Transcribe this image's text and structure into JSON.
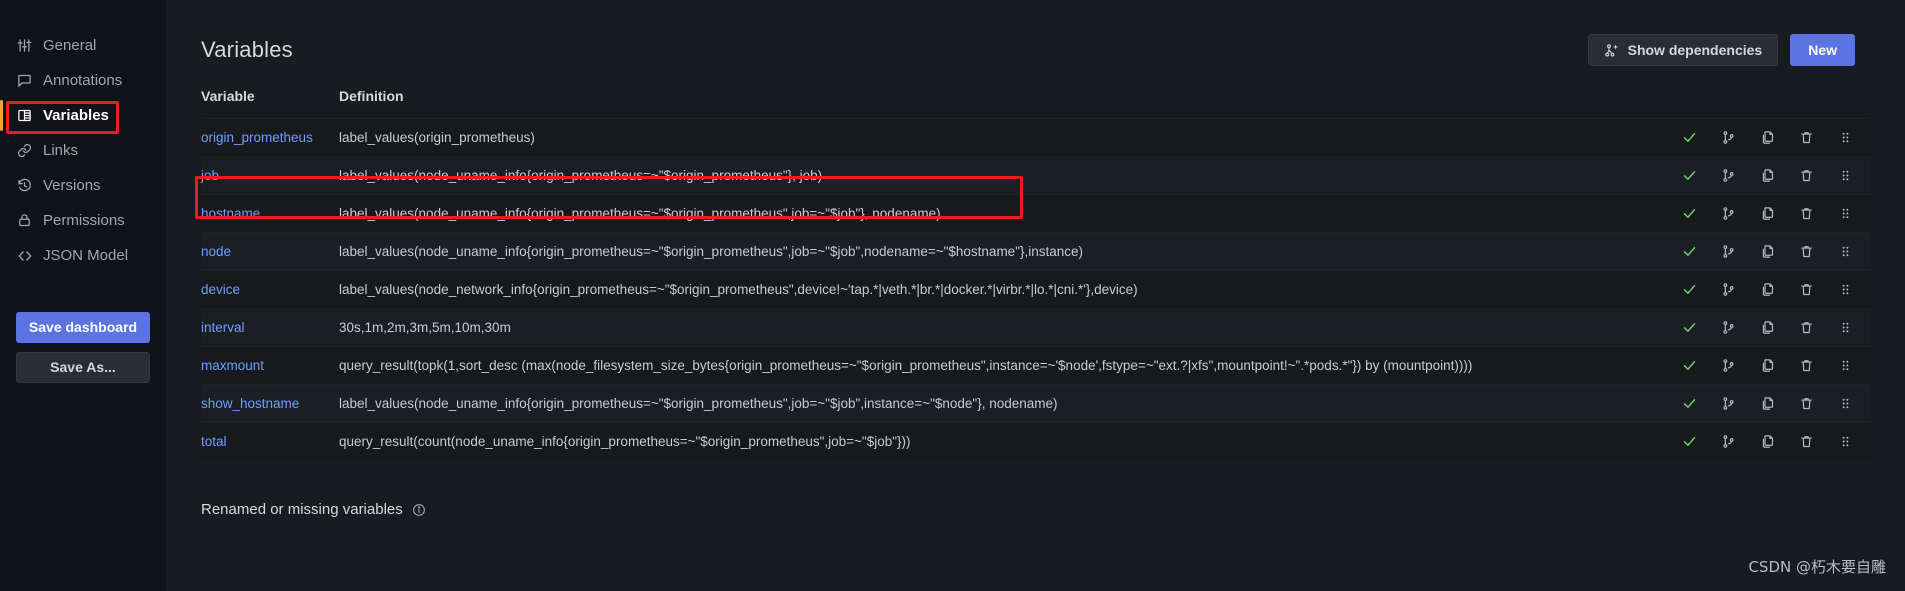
{
  "sidebar": {
    "items": [
      {
        "label": "General",
        "icon": "sliders-icon",
        "active": false
      },
      {
        "label": "Annotations",
        "icon": "comment-square-icon",
        "active": false
      },
      {
        "label": "Variables",
        "icon": "table-grid-icon",
        "active": true
      },
      {
        "label": "Links",
        "icon": "link-icon",
        "active": false
      },
      {
        "label": "Versions",
        "icon": "history-icon",
        "active": false
      },
      {
        "label": "Permissions",
        "icon": "lock-icon",
        "active": false
      },
      {
        "label": "JSON Model",
        "icon": "code-brackets-icon",
        "active": false
      }
    ],
    "save_dashboard_label": "Save dashboard",
    "save_as_label": "Save As..."
  },
  "header": {
    "title": "Variables",
    "show_dependencies_label": "Show dependencies",
    "show_dependencies_icon": "dependency-graph-icon",
    "new_label": "New"
  },
  "table": {
    "columns": [
      "Variable",
      "Definition"
    ],
    "column_variable": "Variable",
    "column_definition": "Definition",
    "row_action_icons": [
      "check-icon",
      "code-branch-icon",
      "duplicate-icon",
      "trash-icon",
      "drag-handle-icon"
    ],
    "rows": [
      {
        "name": "origin_prometheus",
        "definition": "label_values(origin_prometheus)"
      },
      {
        "name": "job",
        "definition": "label_values(node_uname_info{origin_prometheus=~\"$origin_prometheus\"}, job)",
        "highlighted": true
      },
      {
        "name": "hostname",
        "definition": "label_values(node_uname_info{origin_prometheus=~\"$origin_prometheus\",job=~\"$job\"}, nodename)"
      },
      {
        "name": "node",
        "definition": "label_values(node_uname_info{origin_prometheus=~\"$origin_prometheus\",job=~\"$job\",nodename=~\"$hostname\"},instance)"
      },
      {
        "name": "device",
        "definition": "label_values(node_network_info{origin_prometheus=~\"$origin_prometheus\",device!~'tap.*|veth.*|br.*|docker.*|virbr.*|lo.*|cni.*'},device)"
      },
      {
        "name": "interval",
        "definition": "30s,1m,2m,3m,5m,10m,30m"
      },
      {
        "name": "maxmount",
        "definition": "query_result(topk(1,sort_desc (max(node_filesystem_size_bytes{origin_prometheus=~\"$origin_prometheus\",instance=~'$node',fstype=~\"ext.?|xfs\",mountpoint!~\".*pods.*\"}) by (mountpoint))))"
      },
      {
        "name": "show_hostname",
        "definition": "label_values(node_uname_info{origin_prometheus=~\"$origin_prometheus\",job=~\"$job\",instance=~\"$node\"}, nodename)"
      },
      {
        "name": "total",
        "definition": "query_result(count(node_uname_info{origin_prometheus=~\"$origin_prometheus\",job=~\"$job\"}))"
      }
    ]
  },
  "footer": {
    "renamed_missing_label": "Renamed or missing variables",
    "info_icon": "info-circle-icon"
  },
  "watermark": "CSDN @朽木要自雕",
  "colors": {
    "accent_blue": "#5b74e2",
    "link_blue": "#6e9fff",
    "annotation_red": "#ef1b1b",
    "active_marker": "#f2a531",
    "check_green": "#6ccf6c",
    "panel_bg": "#181b1f",
    "sidebar_bg": "#111217"
  }
}
